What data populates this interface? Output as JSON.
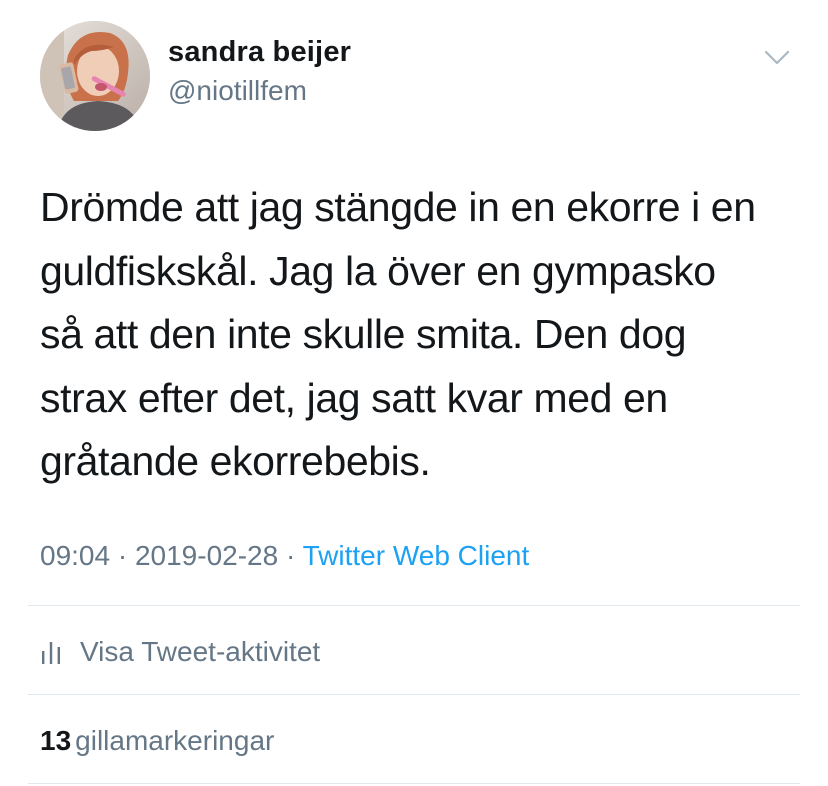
{
  "author": {
    "display_name": "sandra beijer",
    "handle": "@niotillfem"
  },
  "tweet": {
    "text": "Drömde att jag stängde in en ekorre i en\nguldfiskskål. Jag la över en gympasko\nså att den inte skulle smita. Den dog\nstrax efter det, jag satt kvar med en\ngråtande ekorrebebis.",
    "time": "09:04",
    "separator_1": " · ",
    "date": "2019-02-28",
    "separator_2": " · ",
    "source": "Twitter Web Client"
  },
  "activity": {
    "label": "Visa Tweet-aktivitet",
    "icon": "bar-chart-icon"
  },
  "likes": {
    "count": "13",
    "label": "gillamarkeringar"
  },
  "icons": {
    "menu_caret": "chevron-down-icon"
  },
  "colors": {
    "text": "#14171a",
    "secondary": "#657786",
    "link": "#1da1f2",
    "divider": "#e1e8ed"
  }
}
